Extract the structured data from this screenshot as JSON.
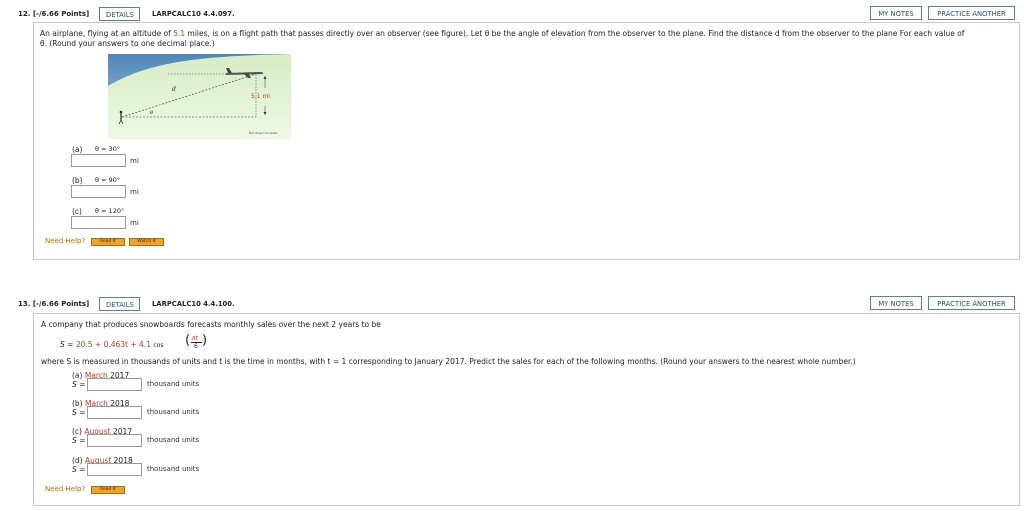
{
  "q12": {
    "number": "12. [-/6.66 Points]",
    "details": "DETAILS",
    "code": "LARPCALC10 4.4.097.",
    "my_notes": "MY NOTES",
    "practice": "PRACTICE ANOTHER",
    "prompt_1": "An airplane, flying at an altitude of",
    "altitude": "5.1",
    "prompt_2": "miles, is on a flight path that passes directly over an observer (see figure). Let θ be the angle of elevation from the observer to the plane. Find the distance d from the observer to the plane For each value of",
    "prompt_3": "θ. (Round your answers to one decimal place.)",
    "figure": {
      "d_label": "d",
      "theta_label": "θ",
      "height_label": "5.1 mi",
      "note": "Not drawn to scale"
    },
    "parts": [
      {
        "label": "(a)",
        "theta": "θ = 30°",
        "unit": "mi"
      },
      {
        "label": "(b)",
        "theta": "θ = 90°",
        "unit": "mi"
      },
      {
        "label": "(c)",
        "theta": "θ = 120°",
        "unit": "mi"
      }
    ],
    "need_help": "Need Help?",
    "read_it": "Read It",
    "watch_it": "Watch It"
  },
  "q13": {
    "number": "13. [-/6.66 Points]",
    "details": "DETAILS",
    "code": "LARPCALC10 4.4.100.",
    "my_notes": "MY NOTES",
    "practice": "PRACTICE ANOTHER",
    "prompt_1": "A company that produces snowboards forecasts monthly sales over the next 2 years to be",
    "formula_lhs": "S =",
    "formula_rhs": "20.5 + 0.463t + 4.1",
    "formula_cos": "cos",
    "formula_num": "πt",
    "formula_den": "6",
    "prompt_2": "where S is measured in thousands of units and t is the time in months, with t = 1 corresponding to January 2017. Predict the sales for each of the following months. (Round your answers to the nearest whole number.)",
    "parts": [
      {
        "label": "(a)",
        "month": "March",
        "year": "2017",
        "s": "S =",
        "unit": "thousand units"
      },
      {
        "label": "(b)",
        "month": "March",
        "year": "2018",
        "s": "S =",
        "unit": "thousand units"
      },
      {
        "label": "(c)",
        "month": "August",
        "year": "2017",
        "s": "S =",
        "unit": "thousand units"
      },
      {
        "label": "(d)",
        "month": "August",
        "year": "2018",
        "s": "S =",
        "unit": "thousand units"
      }
    ],
    "need_help": "Need Help?",
    "read_it": "Read It"
  }
}
